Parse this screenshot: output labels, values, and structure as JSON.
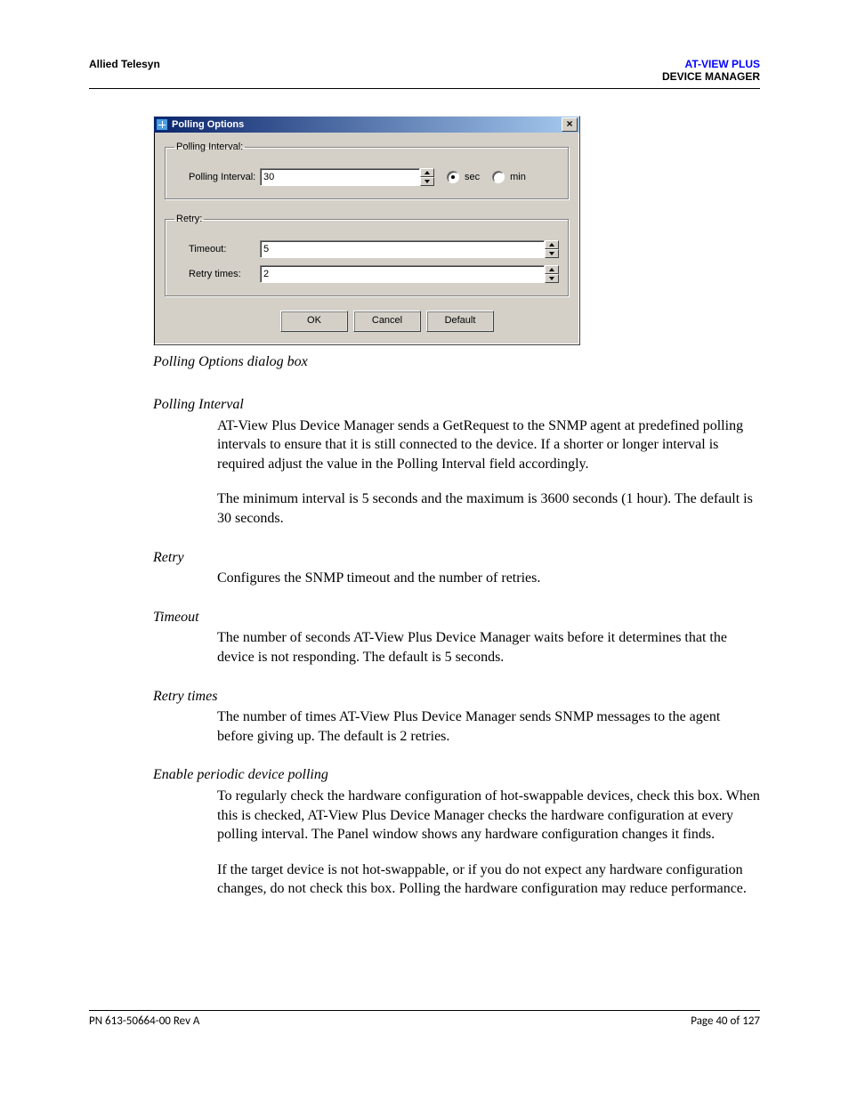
{
  "header": {
    "left": "Allied Telesyn",
    "right_product": "AT-VIEW PLUS",
    "right_section": "DEVICE MANAGER"
  },
  "dialog": {
    "title": "Polling Options",
    "close_x": "×",
    "group_interval": {
      "legend": "Polling Interval:",
      "label": "Polling Interval:",
      "value": "30",
      "unit_sec": "sec",
      "unit_min": "min",
      "selected": "sec"
    },
    "group_retry": {
      "legend": "Retry:",
      "timeout_label": "Timeout:",
      "timeout_value": "5",
      "retry_label": "Retry times:",
      "retry_value": "2"
    },
    "buttons": {
      "ok": "OK",
      "cancel": "Cancel",
      "default": "Default"
    }
  },
  "caption": "Polling Options dialog box",
  "sections": {
    "polling_interval": {
      "heading": "Polling Interval",
      "p1": "AT-View Plus Device Manager sends a GetRequest to the SNMP agent at predefined polling intervals to ensure that it is still connected to the device. If a shorter or longer interval is required adjust the value in the Polling Interval field accordingly.",
      "p2": "The minimum interval is 5 seconds and the maximum is 3600 seconds (1 hour). The default is 30 seconds."
    },
    "retry": {
      "heading": "Retry",
      "p1": "Configures the SNMP timeout and the number of retries."
    },
    "timeout": {
      "heading": "Timeout",
      "p1": "The number of seconds AT-View Plus Device Manager waits before it determines that the device is not responding. The default is 5 seconds."
    },
    "retry_times": {
      "heading": "Retry times",
      "p1": "The number of times AT-View Plus Device Manager sends SNMP messages to the agent before giving up. The default is 2 retries."
    },
    "enable_polling": {
      "heading": "Enable periodic device polling",
      "p1": "To regularly check the hardware configuration of hot-swappable devices, check this box. When this is checked, AT-View Plus Device Manager checks the hardware configuration at every polling interval. The Panel window shows any hardware configuration changes it finds.",
      "p2": "If the target device is not hot-swappable, or if you do not expect any hardware configuration changes, do not check this box. Polling the hardware configuration may reduce performance."
    }
  },
  "footer": {
    "left": "PN 613-50664-00 Rev A",
    "right": "Page 40 of 127"
  }
}
